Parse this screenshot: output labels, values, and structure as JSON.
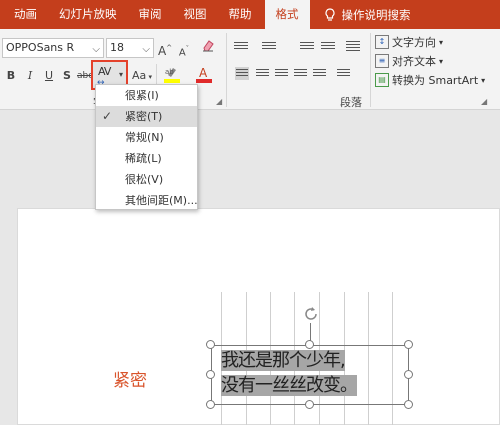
{
  "tabs": [
    {
      "label": "动画",
      "active": false
    },
    {
      "label": "幻灯片放映",
      "active": false
    },
    {
      "label": "审阅",
      "active": false
    },
    {
      "label": "视图",
      "active": false
    },
    {
      "label": "帮助",
      "active": false
    },
    {
      "label": "格式",
      "active": true
    }
  ],
  "tell_me": "操作说明搜索",
  "font": {
    "name": "OPPOSans R",
    "size": "18",
    "grow_label": "A",
    "shrink_label": "A",
    "bold": "B",
    "italic": "I",
    "underline": "U",
    "shadow": "S",
    "strike": "abc",
    "spacing": "AV",
    "spacing_arrow": "↔",
    "case": "Aa",
    "font_color": "A"
  },
  "paragraph": {
    "group_label": "段落",
    "text_direction": "文字方向",
    "align_text": "对齐文本",
    "smartart": "转换为 SmartArt"
  },
  "font_group_label": "字",
  "spacing_menu": {
    "items": [
      {
        "label": "很紧",
        "key": "(I)",
        "checked": false
      },
      {
        "label": "紧密",
        "key": "(T)",
        "checked": true
      },
      {
        "label": "常规",
        "key": "(N)",
        "checked": false
      },
      {
        "label": "稀疏",
        "key": "(L)",
        "checked": false
      },
      {
        "label": "很松",
        "key": "(V)",
        "checked": false
      },
      {
        "label": "其他间距",
        "key": "(M)...",
        "checked": false
      }
    ]
  },
  "slide": {
    "label": "紧密",
    "label_color": "#d9542b",
    "textbox_line1": "我还是那个少年,",
    "textbox_line2": "没有一丝丝改变。"
  },
  "colors": {
    "tab_bar": "#c43e1c",
    "highlight_box": "#e4412b",
    "highlighter": "#ffff00",
    "font_color_bar": "#e02a2a"
  }
}
